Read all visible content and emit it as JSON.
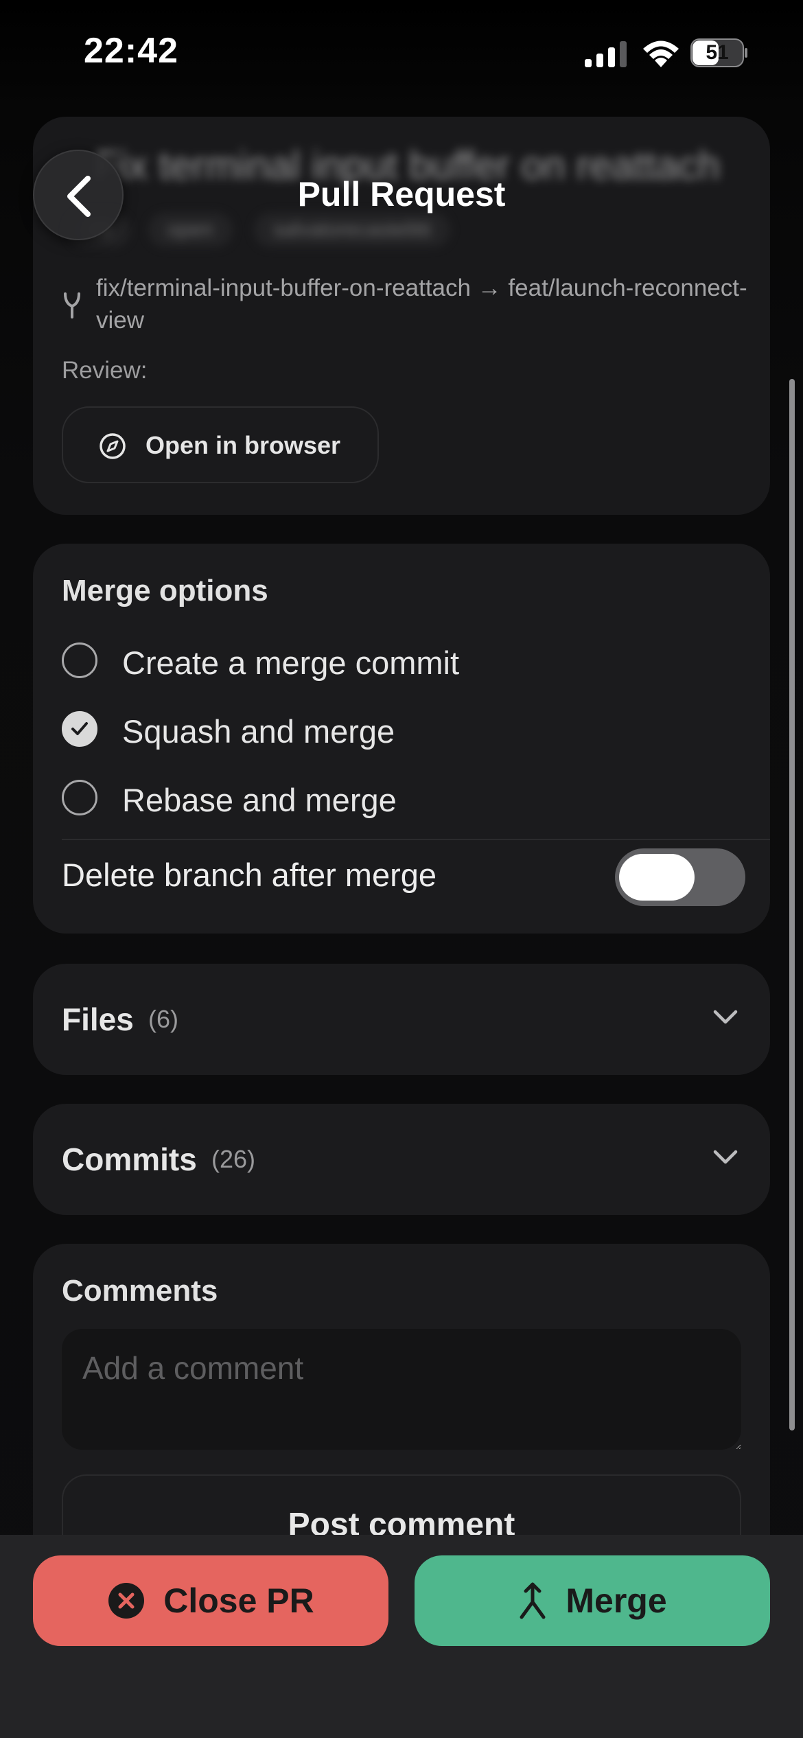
{
  "status_bar": {
    "time": "22:42",
    "battery_level": "51",
    "icons": [
      "signal-icon",
      "wifi-icon",
      "battery-icon"
    ]
  },
  "nav": {
    "title": "Pull Request",
    "back_icon": "chevron-left-icon"
  },
  "header": {
    "pr_title": "Fix terminal input buffer on reattach",
    "pills": [
      "#9",
      "open",
      "salvatorecastelitti"
    ],
    "branch_text": "fix/terminal-input-buffer-on-reattach → feat/launch-reconnect-view",
    "branch_icon": "branch-icon",
    "review_label": "Review:",
    "open_browser_label": "Open in browser",
    "open_browser_icon": "compass-icon"
  },
  "merge_options": {
    "title": "Merge options",
    "options": [
      {
        "label": "Create a merge commit",
        "selected": false
      },
      {
        "label": "Squash and merge",
        "selected": true
      },
      {
        "label": "Rebase and merge",
        "selected": false
      }
    ],
    "delete_branch_label": "Delete branch after merge",
    "delete_branch_enabled": true
  },
  "files": {
    "title": "Files",
    "count": "(6)"
  },
  "commits": {
    "title": "Commits",
    "count": "(26)"
  },
  "comments": {
    "title": "Comments",
    "placeholder": "Add a comment",
    "value": "",
    "post_label": "Post comment"
  },
  "actions": {
    "close_label": "Close PR",
    "merge_label": "Merge"
  },
  "colors": {
    "close": "#e5655f",
    "merge": "#4fb78d",
    "card": "#1b1b1d",
    "background": "#0d0d0e"
  }
}
